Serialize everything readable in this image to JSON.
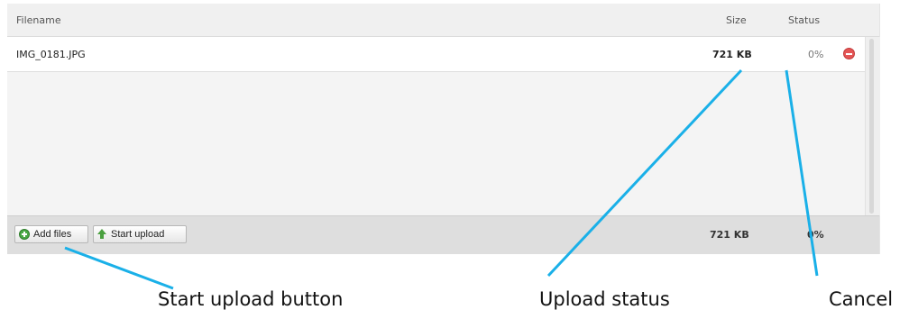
{
  "table": {
    "headers": {
      "filename": "Filename",
      "size": "Size",
      "status": "Status"
    },
    "files": [
      {
        "name": "IMG_0181.JPG",
        "size": "721 KB",
        "status": "0%"
      }
    ]
  },
  "footer": {
    "add_files_label": "Add files",
    "start_upload_label": "Start upload",
    "total_size": "721 KB",
    "total_status": "0%"
  },
  "annotations": {
    "start_upload": "Start upload button",
    "upload_status": "Upload status",
    "cancel": "Cancel"
  },
  "colors": {
    "callout": "#1ab0e8",
    "remove": "#e45555",
    "add_icon": "#49a845",
    "upload_icon": "#4aa03f"
  },
  "icons": {
    "add": "plus-circle-icon",
    "upload": "up-arrow-icon",
    "remove": "minus-circle-icon"
  }
}
